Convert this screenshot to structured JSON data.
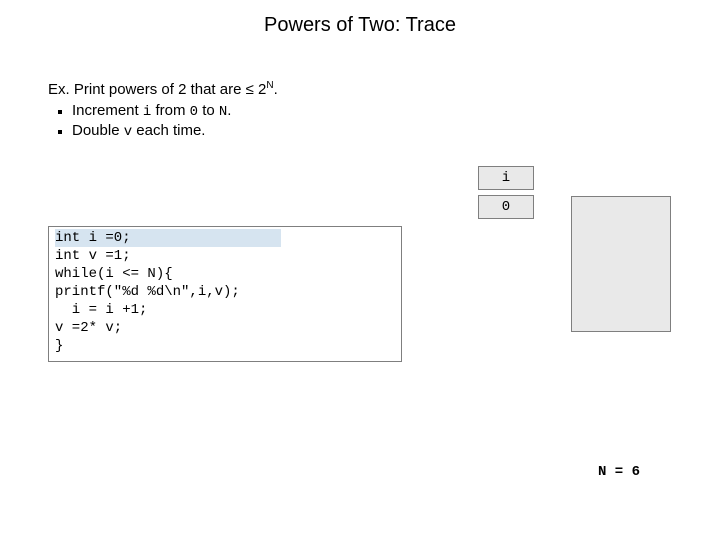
{
  "title": "Powers of Two:  Trace",
  "example": {
    "label": "Ex.",
    "text_before": "Print powers of 2 that are ",
    "leq": "≤",
    "base": "2",
    "exp": "N",
    "text_after": "."
  },
  "bullets": [
    {
      "pre": "Increment ",
      "code1": "i",
      "mid": " from ",
      "code2": "0",
      "mid2": " to ",
      "code3": "N",
      "post": "."
    },
    {
      "pre": "Double ",
      "code1": "v",
      "mid": " each time.",
      "code2": "",
      "mid2": "",
      "code3": "",
      "post": ""
    }
  ],
  "trace": {
    "header": "i",
    "value": "0"
  },
  "code": {
    "l1": "int i =0;",
    "l2": "int v =1;",
    "l3": "while(i <= N){",
    "l4": "printf(\"%d %d\\n\",i,v);",
    "l5": "  i = i +1;",
    "l6": "v =2* v;",
    "l7": "}"
  },
  "footer": "N = 6"
}
